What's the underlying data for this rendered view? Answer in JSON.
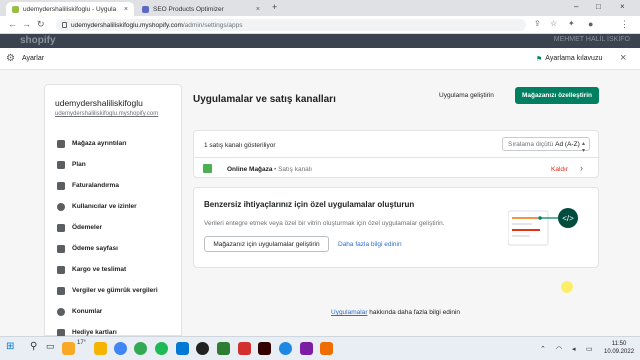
{
  "browser": {
    "tabs": [
      {
        "label": "udemydershaliliskifoglu - Uygula",
        "active": true
      },
      {
        "label": "SEO Products Optimizer",
        "active": false
      }
    ],
    "url_host": "udemydershaliliskifoglu.myshopify.com",
    "url_path": "/admin/settings/apps"
  },
  "shop_header": {
    "logo": "shopify",
    "user": "MEHMET HALİL İSKİFO"
  },
  "modal": {
    "title": "Ayarlar",
    "guide_label": "Ayarlama kılavuzu"
  },
  "sidebar": {
    "store_name": "udemydershaliliskifoglu",
    "store_url": "udemydershaliliskifoglu.myshopify.com",
    "items": [
      {
        "label": "Mağaza ayrıntıları",
        "icon": "store-icon"
      },
      {
        "label": "Plan",
        "icon": "plan-icon"
      },
      {
        "label": "Faturalandırma",
        "icon": "billing-icon"
      },
      {
        "label": "Kullanıcılar ve izinler",
        "icon": "user-icon"
      },
      {
        "label": "Ödemeler",
        "icon": "payment-icon"
      },
      {
        "label": "Ödeme sayfası",
        "icon": "checkout-icon"
      },
      {
        "label": "Kargo ve teslimat",
        "icon": "truck-icon"
      },
      {
        "label": "Vergiler ve gümrük vergileri",
        "icon": "tax-icon"
      },
      {
        "label": "Konumlar",
        "icon": "location-icon"
      },
      {
        "label": "Hediye kartları",
        "icon": "gift-card-icon"
      }
    ]
  },
  "main": {
    "title": "Uygulamalar ve satış kanalları",
    "develop_label": "Uygulama geliştirin",
    "customize_label": "Mağazanızı özelleştirin",
    "channels": {
      "count_text": "1 satış kanalı gösteriliyor",
      "sort_prefix": "Sıralama ölçütü",
      "sort_value": "Ad (A-Z)",
      "row": {
        "name": "Online Mağaza",
        "type": "• Satış kanalı",
        "remove_label": "Kaldır"
      }
    },
    "custom_apps": {
      "title": "Benzersiz ihtiyaçlarınız için özel uygulamalar oluşturun",
      "description": "Verileri entegre etmek veya özel bir vitrin oluşturmak için özel uygulamalar geliştirin.",
      "button_label": "Mağazanız için uygulamalar geliştirin",
      "link_label": "Daha fazla bilgi edinin"
    },
    "footer": {
      "link": "Uygulamalar",
      "text": " hakkında daha fazla bilgi edinin"
    }
  },
  "taskbar": {
    "weather": "17°",
    "time": "11:50",
    "date": "10.09.2022",
    "accent": "#0078d4"
  },
  "colors": {
    "primary": "#008060",
    "link": "#2c6ecb",
    "critical": "#d72c0d"
  }
}
